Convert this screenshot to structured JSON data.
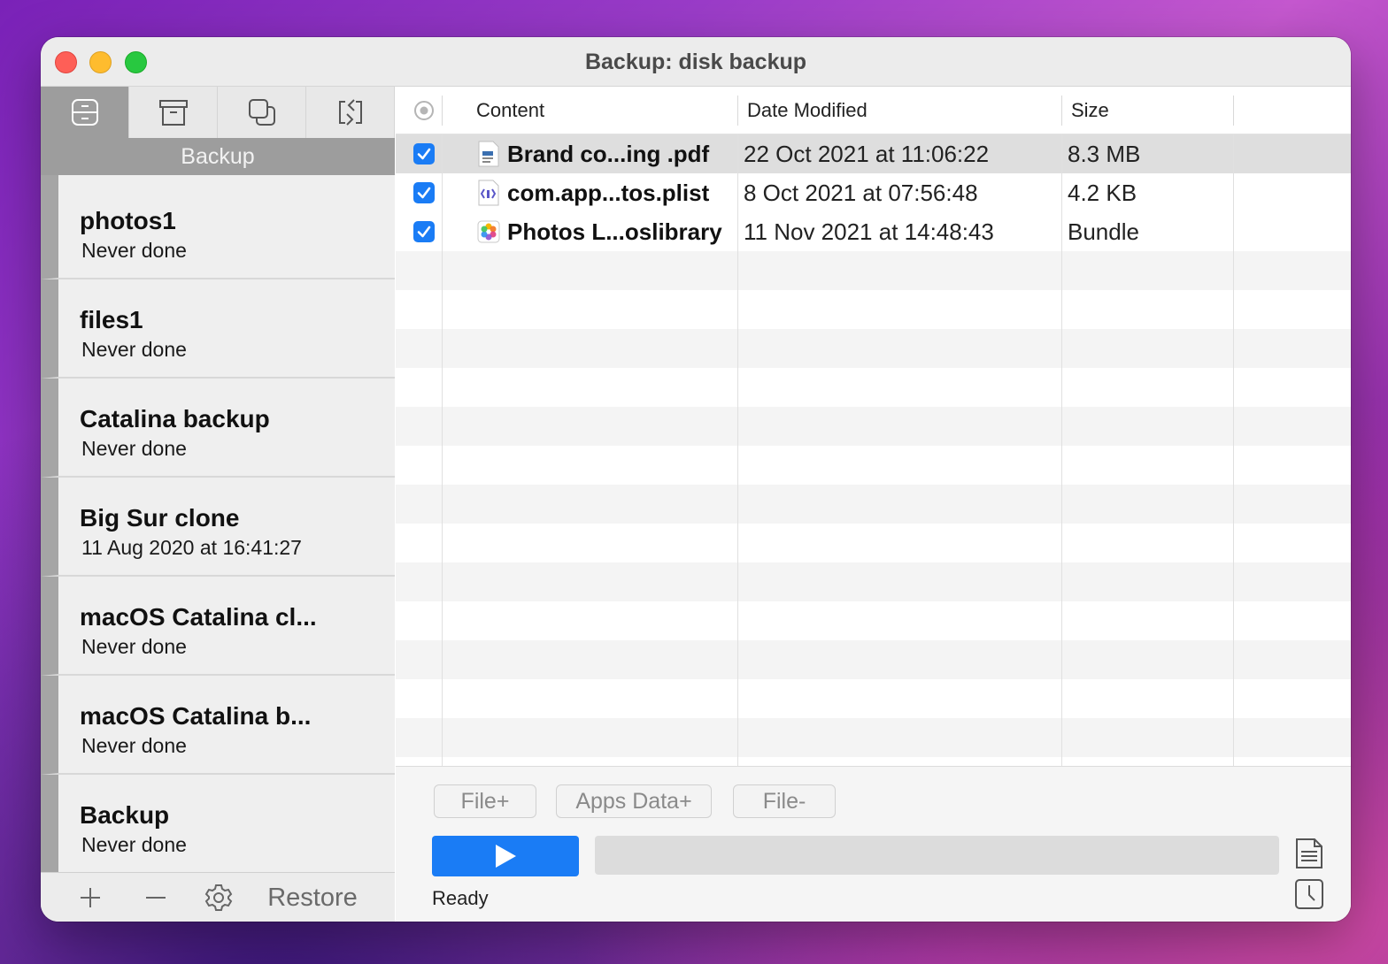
{
  "window": {
    "title": "Backup: disk backup"
  },
  "sidebar": {
    "tabs": [
      {
        "name": "backup-tab",
        "icon": "drawer-cabinet-icon",
        "active": true
      },
      {
        "name": "archive-tab",
        "icon": "archive-box-icon",
        "active": false
      },
      {
        "name": "clone-tab",
        "icon": "clone-squares-icon",
        "active": false
      },
      {
        "name": "sync-tab",
        "icon": "sync-arrows-icon",
        "active": false
      }
    ],
    "section_label": "Backup",
    "items": [
      {
        "name": "photos1",
        "status": "Never done"
      },
      {
        "name": "files1",
        "status": "Never done"
      },
      {
        "name": "Catalina backup",
        "status": "Never done"
      },
      {
        "name": "Big Sur clone",
        "status": "11 Aug 2020 at 16:41:27"
      },
      {
        "name": "macOS Catalina cl...",
        "status": "Never done"
      },
      {
        "name": "macOS Catalina b...",
        "status": "Never done"
      },
      {
        "name": "Backup",
        "status": "Never done"
      }
    ],
    "bottom": {
      "add_icon": "plus-icon",
      "remove_icon": "minus-icon",
      "settings_icon": "gear-icon",
      "restore_label": "Restore"
    }
  },
  "table": {
    "columns": {
      "content": "Content",
      "date": "Date Modified",
      "size": "Size"
    },
    "rows": [
      {
        "checked": true,
        "icon": "pdf-file-icon",
        "name": "Brand co...ing .pdf",
        "date": "22 Oct 2021 at 11:06:22",
        "size": "8.3 MB",
        "selected": true
      },
      {
        "checked": true,
        "icon": "plist-file-icon",
        "name": "com.app...tos.plist",
        "date": "8 Oct 2021 at 07:56:48",
        "size": "4.2 KB",
        "selected": false
      },
      {
        "checked": true,
        "icon": "photos-library-icon",
        "name": "Photos L...oslibrary",
        "date": "11 Nov 2021 at 14:48:43",
        "size": "Bundle",
        "selected": false
      }
    ]
  },
  "footer": {
    "file_plus": "File+",
    "apps_data_plus": "Apps Data+",
    "file_minus": "File-",
    "status": "Ready",
    "progress": 0
  },
  "colors": {
    "accent": "#1a7cf5",
    "sidebar_active": "#9d9d9d"
  }
}
